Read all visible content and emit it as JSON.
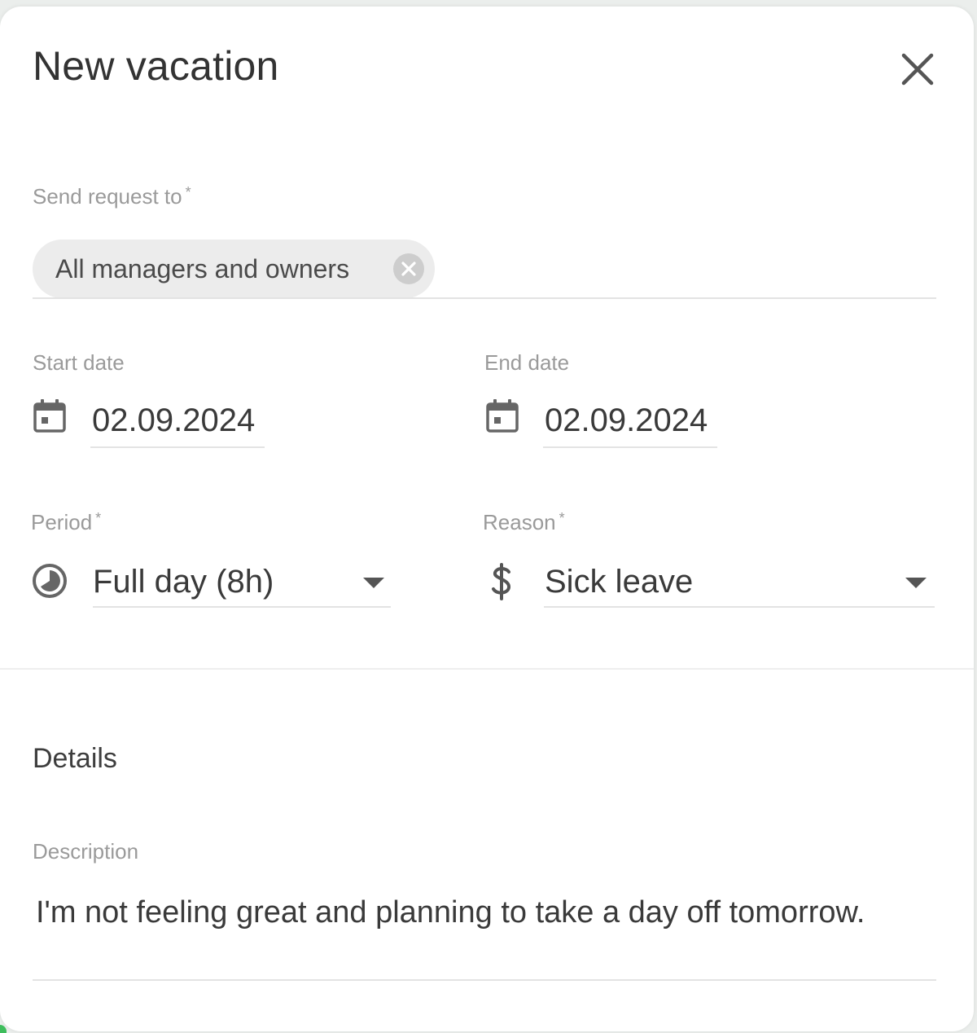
{
  "dialog": {
    "title": "New vacation",
    "close_icon": "close-icon"
  },
  "recipient": {
    "label": "Send request to",
    "required_marker": "*",
    "chip_label": "All managers and owners",
    "remove_icon": "remove-chip-icon"
  },
  "start_date": {
    "label": "Start date",
    "value": "02.09.2024",
    "icon": "calendar-icon"
  },
  "end_date": {
    "label": "End date",
    "value": "02.09.2024",
    "icon": "calendar-icon"
  },
  "period": {
    "label": "Period",
    "required_marker": "*",
    "value": "Full day (8h)",
    "icon": "clock-icon"
  },
  "reason": {
    "label": "Reason",
    "required_marker": "*",
    "value": "Sick leave",
    "icon": "dollar-icon"
  },
  "details": {
    "heading": "Details",
    "description_label": "Description",
    "description_value": "I'm not feeling great and planning to take a day off tomorrow."
  },
  "colors": {
    "accent": "#3ebd5c",
    "label": "#9a9a9a",
    "text": "#3a3a3a",
    "chip_bg": "#ececec"
  }
}
